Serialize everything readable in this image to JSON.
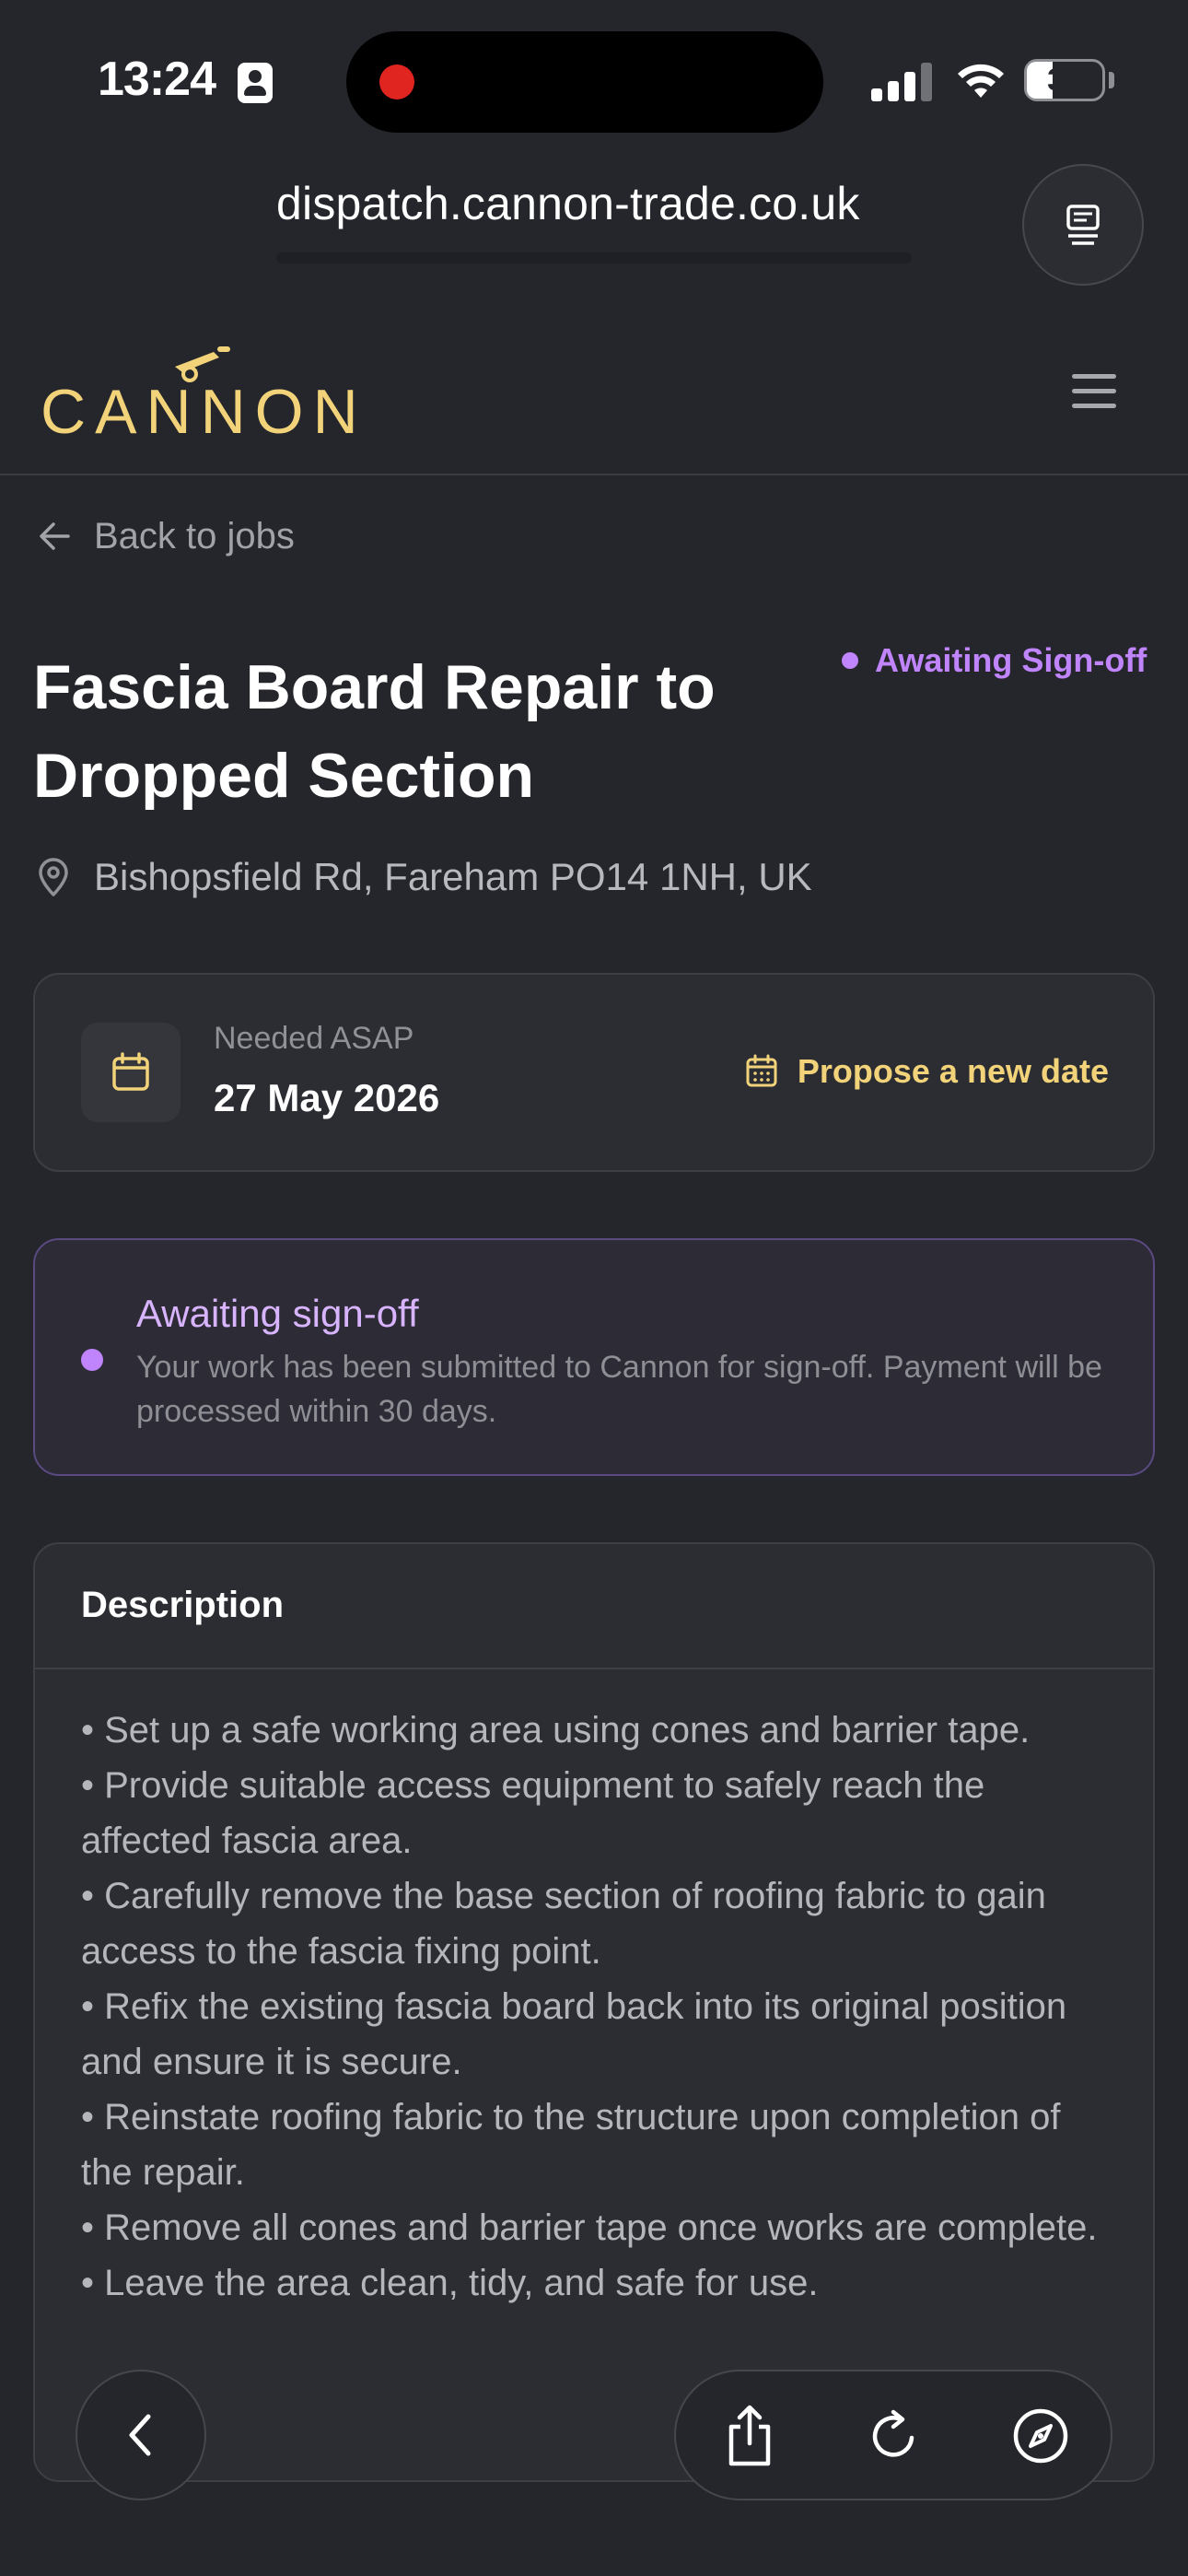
{
  "status_bar": {
    "time": "13:24",
    "battery": "34",
    "icons": [
      "contact-card-icon",
      "signal-icon",
      "wifi-icon",
      "battery-icon"
    ]
  },
  "browser": {
    "url": "dispatch.cannon-trade.co.uk",
    "reader_icon": "reader-mode-icon"
  },
  "header": {
    "logo_text": "CANNON",
    "menu_icon": "hamburger-menu-icon"
  },
  "back": {
    "label": "Back to jobs"
  },
  "job": {
    "title": "Fascia Board Repair to Dropped Section",
    "status": "Awaiting Sign-off",
    "address": "Bishopsfield Rd, Fareham PO14 1NH, UK"
  },
  "date_card": {
    "label": "Needed ASAP",
    "value": "27 May 2026",
    "propose_label": "Propose a new date"
  },
  "signoff": {
    "title": "Awaiting sign-off",
    "body": "Your work has been submitted to Cannon for sign-off. Payment will be processed within 30 days."
  },
  "description": {
    "heading": "Description",
    "lines": [
      "• Set up a safe working area using cones and barrier tape.",
      "• Provide suitable access equipment to safely reach the affected fascia area.",
      "• Carefully remove the base section of roofing fabric to gain access to the fascia fixing point.",
      "• Refix the existing fascia board back into its original position and ensure it is secure.",
      "• Reinstate roofing fabric to the structure upon completion of the repair.",
      "• Remove all cones and barrier tape once works are complete.",
      "• Leave the area clean, tidy, and safe for use."
    ]
  },
  "toolbar": {
    "icons": [
      "back-chevron-icon",
      "share-icon",
      "reload-icon",
      "compass-icon"
    ]
  },
  "colors": {
    "background": "#24262b",
    "card": "#2b2d32",
    "accent_gold": "#f2d37a",
    "status_purple": "#c084fc"
  }
}
